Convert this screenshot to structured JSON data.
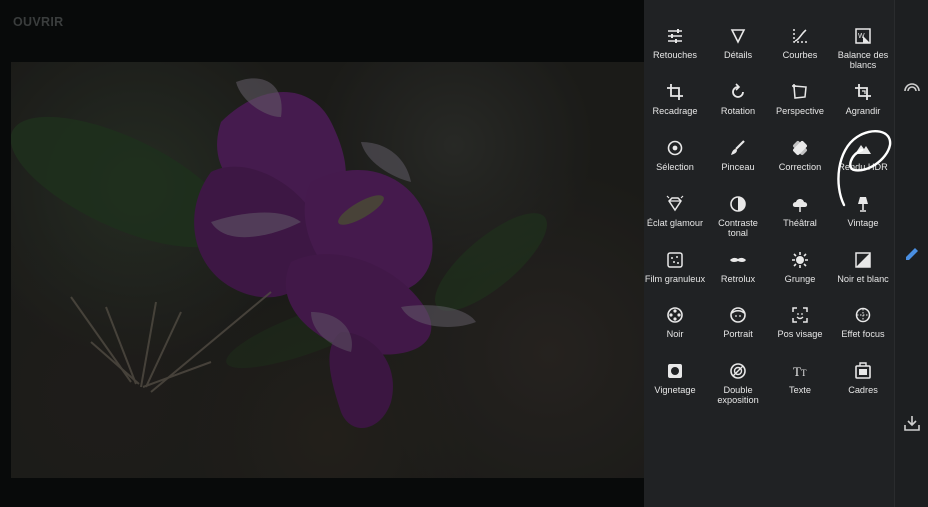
{
  "header": {
    "open_label": "OUVRIR"
  },
  "tools": [
    {
      "label": "Retouches",
      "icon": "sliders-icon"
    },
    {
      "label": "Détails",
      "icon": "triangle-icon"
    },
    {
      "label": "Courbes",
      "icon": "curves-icon"
    },
    {
      "label": "Balance des blancs",
      "icon": "white-balance-icon"
    },
    {
      "label": "Recadrage",
      "icon": "crop-icon"
    },
    {
      "label": "Rotation",
      "icon": "rotate-icon"
    },
    {
      "label": "Perspective",
      "icon": "perspective-icon"
    },
    {
      "label": "Agrandir",
      "icon": "expand-icon"
    },
    {
      "label": "Sélection",
      "icon": "target-icon"
    },
    {
      "label": "Pinceau",
      "icon": "brush-icon"
    },
    {
      "label": "Correction",
      "icon": "bandage-icon"
    },
    {
      "label": "Rendu HDR",
      "icon": "mountain-icon"
    },
    {
      "label": "Éclat glamour",
      "icon": "diamond-icon"
    },
    {
      "label": "Contraste tonal",
      "icon": "contrast-icon"
    },
    {
      "label": "Théâtral",
      "icon": "cloud-icon"
    },
    {
      "label": "Vintage",
      "icon": "lamp-icon"
    },
    {
      "label": "Film granuleux",
      "icon": "grain-icon"
    },
    {
      "label": "Retrolux",
      "icon": "mustache-icon"
    },
    {
      "label": "Grunge",
      "icon": "grunge-icon"
    },
    {
      "label": "Noir et blanc",
      "icon": "bw-icon"
    },
    {
      "label": "Noir",
      "icon": "film-reel-icon"
    },
    {
      "label": "Portrait",
      "icon": "face-icon"
    },
    {
      "label": "Pos visage",
      "icon": "face-focus-icon"
    },
    {
      "label": "Effet focus",
      "icon": "focus-icon"
    },
    {
      "label": "Vignetage",
      "icon": "vignette-icon"
    },
    {
      "label": "Double exposition",
      "icon": "double-exposure-icon"
    },
    {
      "label": "Texte",
      "icon": "text-icon"
    },
    {
      "label": "Cadres",
      "icon": "frame-icon"
    }
  ],
  "rail": {
    "top_icon": "styles-icon",
    "middle_icon": "edit-pencil-icon",
    "bottom_icon": "export-icon",
    "accent_color": "#4a8fe2"
  }
}
